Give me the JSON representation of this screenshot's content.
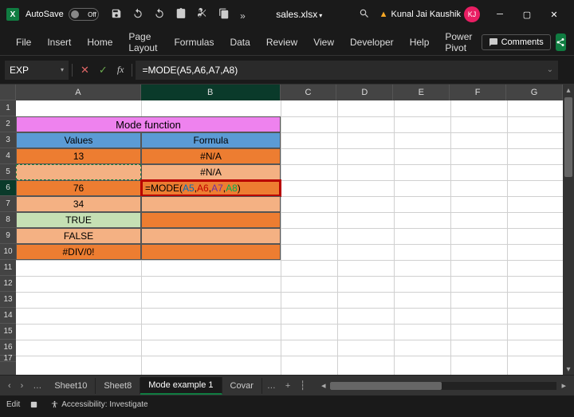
{
  "titlebar": {
    "app_icon_text": "X",
    "autosave_label": "AutoSave",
    "autosave_state": "Off",
    "filename": "sales.xlsx",
    "search_icon": "search",
    "user_name": "Kunal Jai Kaushik",
    "user_initials": "KJ"
  },
  "ribbon": {
    "tabs": [
      "File",
      "Insert",
      "Home",
      "Page Layout",
      "Formulas",
      "Data",
      "Review",
      "View",
      "Developer",
      "Help",
      "Power Pivot"
    ],
    "comments_label": "Comments"
  },
  "formula_bar": {
    "namebox": "EXP",
    "formula": "=MODE(A5,A6,A7,A8)"
  },
  "columns": [
    "A",
    "B",
    "C",
    "D",
    "E",
    "F",
    "G"
  ],
  "rows": [
    "1",
    "2",
    "3",
    "4",
    "5",
    "6",
    "7",
    "8",
    "9",
    "10",
    "11",
    "12",
    "13",
    "14",
    "15",
    "16",
    "17"
  ],
  "cells": {
    "title": "Mode function",
    "hA": "Values",
    "hB": "Formula",
    "A4": "13",
    "A5": "",
    "A6": "76",
    "A7": "34",
    "A8": "TRUE",
    "A9": "FALSE",
    "A10": "#DIV/0!",
    "B4": "#N/A",
    "B5": "#N/A",
    "B6_parts": {
      "pre": "=MODE(",
      "a5": "A5",
      "a6": "A6",
      "a7": "A7",
      "a8": "A8",
      "close": ")"
    }
  },
  "sheet_tabs": {
    "tabs": [
      "Sheet10",
      "Sheet8",
      "Mode example 1",
      "Covar"
    ],
    "active_index": 2
  },
  "statusbar": {
    "mode": "Edit",
    "accessibility": "Accessibility: Investigate"
  }
}
